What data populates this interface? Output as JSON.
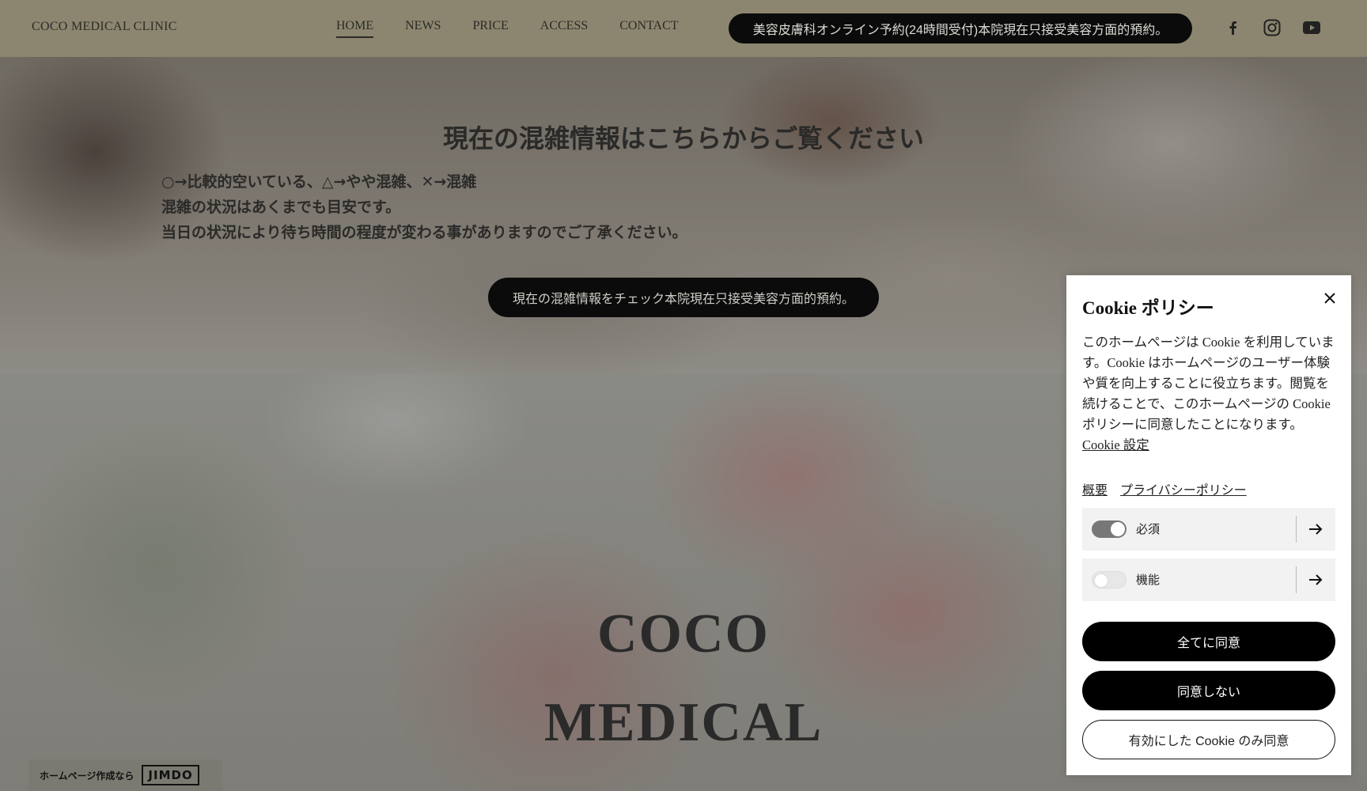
{
  "header": {
    "logo": "COCO MEDICAL CLINIC",
    "nav": [
      {
        "label": "HOME",
        "active": true
      },
      {
        "label": "NEWS",
        "active": false
      },
      {
        "label": "PRICE",
        "active": false
      },
      {
        "label": "ACCESS",
        "active": false
      },
      {
        "label": "CONTACT",
        "active": false
      }
    ],
    "reserve_label": "美容皮膚科オンライン予約(24時間受付)本院現在只接受美容方面的預約。",
    "social_icons": [
      "facebook-icon",
      "instagram-icon",
      "youtube-icon"
    ]
  },
  "hero": {
    "title": "現在の混雑情報はこちらからご覧ください",
    "lines": [
      "○→比較的空いている、△→やや混雑、✕→混雑",
      "混雑の状況はあくまでも目安です。",
      "当日の状況により待ち時間の程度が変わる事がありますのでご了承ください。"
    ],
    "check_button": "現在の混雑情報をチェック本院現在只接受美容方面的預約。"
  },
  "lower": {
    "title_line1": "COCO",
    "title_line2": "MEDICAL"
  },
  "jimdo": {
    "text": "ホームページ作成なら",
    "logo": "JIMDO"
  },
  "cookie": {
    "title": "Cookie ポリシー",
    "body": "このホームページは Cookie を利用しています。Cookie はホームページのユーザー体験や質を向上することに役立ちます。閲覧を続けることで、このホームページの Cookie ポリシーに同意したことになります。",
    "settings_link": "Cookie 設定",
    "links": [
      "概要",
      "プライバシーポリシー"
    ],
    "categories": [
      {
        "label": "必須",
        "enabled": true
      },
      {
        "label": "機能",
        "enabled": false
      }
    ],
    "accept_all": "全てに同意",
    "decline": "同意しない",
    "accept_enabled": "有効にした Cookie のみ同意"
  },
  "colors": {
    "header_bg": "#8c8670",
    "button_dark": "#0b0b0b",
    "panel_bg": "#ffffff"
  }
}
